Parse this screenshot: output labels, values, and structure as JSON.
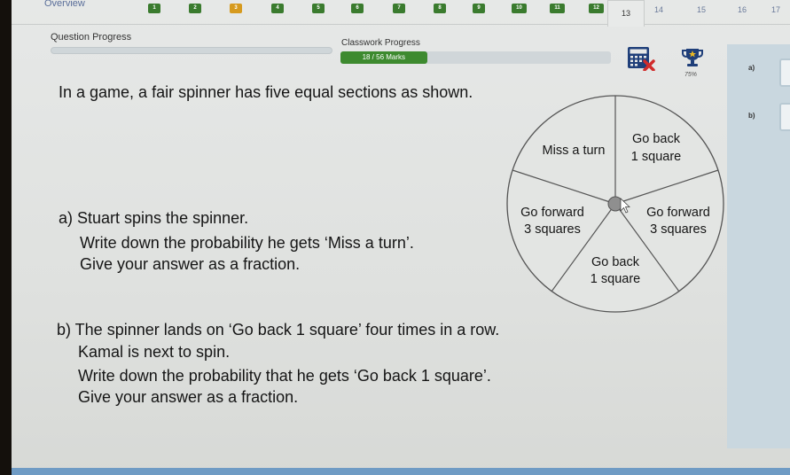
{
  "nav": {
    "overview_label": "Overview",
    "questions": [
      {
        "num": "1",
        "status": "complete"
      },
      {
        "num": "2",
        "status": "complete"
      },
      {
        "num": "3",
        "status": "partial"
      },
      {
        "num": "4",
        "status": "complete"
      },
      {
        "num": "5",
        "status": "complete"
      },
      {
        "num": "6",
        "status": "complete"
      },
      {
        "num": "7",
        "status": "complete"
      },
      {
        "num": "8",
        "status": "complete"
      },
      {
        "num": "9",
        "status": "complete"
      },
      {
        "num": "10",
        "status": "complete"
      },
      {
        "num": "11",
        "status": "complete"
      },
      {
        "num": "12",
        "status": "complete"
      },
      {
        "num": "13",
        "status": "current"
      },
      {
        "num": "14",
        "status": "unanswered"
      },
      {
        "num": "15",
        "status": "unanswered"
      },
      {
        "num": "16",
        "status": "unanswered"
      },
      {
        "num": "17",
        "status": "unanswered"
      }
    ]
  },
  "progress": {
    "question_label": "Question Progress",
    "question_fraction": 0,
    "classwork_label": "Classwork Progress",
    "classwork_text": "18 / 56 Marks",
    "classwork_marks": 18,
    "classwork_total": 56
  },
  "tools": {
    "calculator_icon": "calculator-not-allowed-icon",
    "trophy_icon": "trophy-icon",
    "trophy_percent": "75%"
  },
  "colors": {
    "complete": "#3a7b2e",
    "partial": "#d69a1e",
    "progress_fill": "#3d8a2f",
    "calc_blue": "#1f3f7a",
    "calc_cross": "#d12b2b"
  },
  "question": {
    "intro": "In a game, a fair spinner has five equal sections as shown.",
    "part_a": {
      "line1": "a) Stuart spins the spinner.",
      "line2": "Write down the probability he gets ‘Miss a turn’.",
      "line3": "Give your answer as a fraction."
    },
    "part_b": {
      "line1": "b) The spinner lands on ‘Go back 1 square’ four times in a row.",
      "line2": "Kamal is next to spin.",
      "line3": "Write down the probability that he gets ‘Go back 1 square’.",
      "line4": "Give your answer as a fraction."
    }
  },
  "spinner": {
    "sections": [
      {
        "line1": "Go back",
        "line2": "1 square"
      },
      {
        "line1": "Go forward",
        "line2": "3 squares"
      },
      {
        "line1": "Go back",
        "line2": "1 square"
      },
      {
        "line1": "Go forward",
        "line2": "3 squares"
      },
      {
        "line1": "Miss a turn",
        "line2": ""
      }
    ]
  },
  "answers": {
    "a_label": "a)",
    "a_value": "",
    "b_label": "b)",
    "b_value": ""
  }
}
